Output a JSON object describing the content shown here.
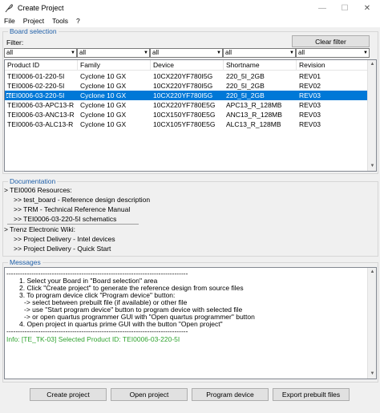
{
  "window": {
    "title": "Create Project",
    "minimize_glyph": "—",
    "maximize_glyph": "☐",
    "close_glyph": "✕"
  },
  "menu": [
    "File",
    "Project",
    "Tools",
    "?"
  ],
  "board_selection": {
    "title": "Board selection",
    "filter_label": "Filter:",
    "clear_filter_label": "Clear filter",
    "filters": [
      "all",
      "all",
      "all",
      "all",
      "all"
    ],
    "columns": [
      "Product ID",
      "Family",
      "Device",
      "Shortname",
      "Revision"
    ],
    "rows": [
      [
        "TEI0006-01-220-5I",
        "Cyclone 10 GX",
        "10CX220YF780I5G",
        "220_5I_2GB",
        "REV01"
      ],
      [
        "TEI0006-02-220-5I",
        "Cyclone 10 GX",
        "10CX220YF780I5G",
        "220_5I_2GB",
        "REV02"
      ],
      [
        "TEI0006-03-220-5I",
        "Cyclone 10 GX",
        "10CX220YF780I5G",
        "220_5I_2GB",
        "REV03"
      ],
      [
        "TEI0006-03-APC13-R",
        "Cyclone 10 GX",
        "10CX220YF780E5G",
        "APC13_R_128MB",
        "REV03"
      ],
      [
        "TEI0006-03-ANC13-R",
        "Cyclone 10 GX",
        "10CX150YF780E5G",
        "ANC13_R_128MB",
        "REV03"
      ],
      [
        "TEI0006-03-ALC13-R",
        "Cyclone 10 GX",
        "10CX105YF780E5G",
        "ALC13_R_128MB",
        "REV03"
      ]
    ],
    "selected_row": 2
  },
  "documentation": {
    "title": "Documentation",
    "lines": [
      "> TEI0006 Resources:",
      ">> test_board - Reference design description",
      ">> TRM - Technical Reference Manual",
      ">> TEI0006-03-220-5I schematics",
      "> Trenz Electronic Wiki:",
      ">> Project Delivery - Intel devices",
      ">> Project Delivery - Quick Start"
    ]
  },
  "messages": {
    "title": "Messages",
    "lines": [
      "--------------------------------------------------------------------------------",
      "1. Select your Board in \"Board selection\" area",
      "2. Click \"Create project\" to generate the reference design from source files",
      "3. To program device click \"Program device\" button:",
      "-> select between prebuilt file (if available) or other file",
      "-> use \"Start program device\" button to program device with selected file",
      "-> or open quartus programmer GUI with \"Open quartus programmer\" button",
      "4. Open project in quartus prime GUI with the button \"Open project\"",
      "--------------------------------------------------------------------------------",
      "Info: [TE_TK-03] Selected Product ID: TEI0006-03-220-5I"
    ]
  },
  "buttons": {
    "create_project": "Create project",
    "open_project": "Open project",
    "program_device": "Program device",
    "export_prebuilt": "Export prebuilt files"
  },
  "colors": {
    "selection": "#0078d7",
    "group_title": "#1f5fa8",
    "info_text": "#2fa32f"
  }
}
